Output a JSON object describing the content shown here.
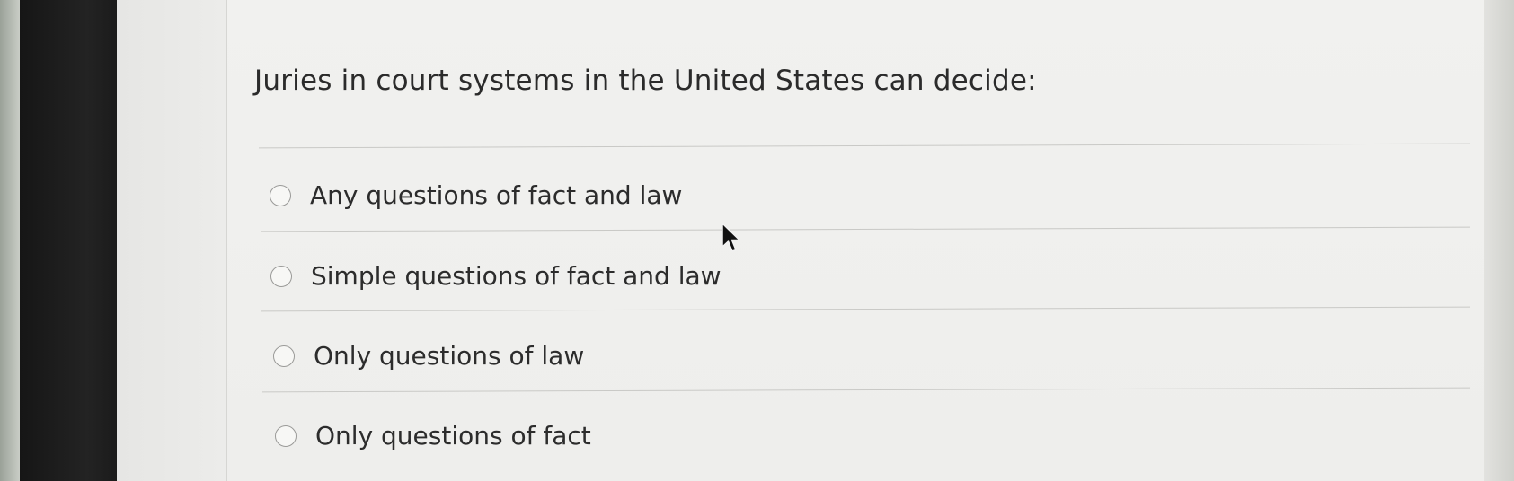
{
  "quiz": {
    "question": "Juries in court systems in the United States can decide:",
    "options": [
      {
        "label": "Any questions of fact and law",
        "selected": false
      },
      {
        "label": "Simple questions of fact and law",
        "selected": false
      },
      {
        "label": "Only questions of law",
        "selected": false
      },
      {
        "label": "Only questions of fact",
        "selected": false
      }
    ]
  },
  "icons": {
    "radio": "radio-button-icon",
    "pointer": "mouse-pointer-icon"
  },
  "colors": {
    "panel_background": "#eeeeec",
    "text": "#2b2b2b",
    "divider": "#c9c9c6",
    "radio_border": "#9a9a98"
  }
}
